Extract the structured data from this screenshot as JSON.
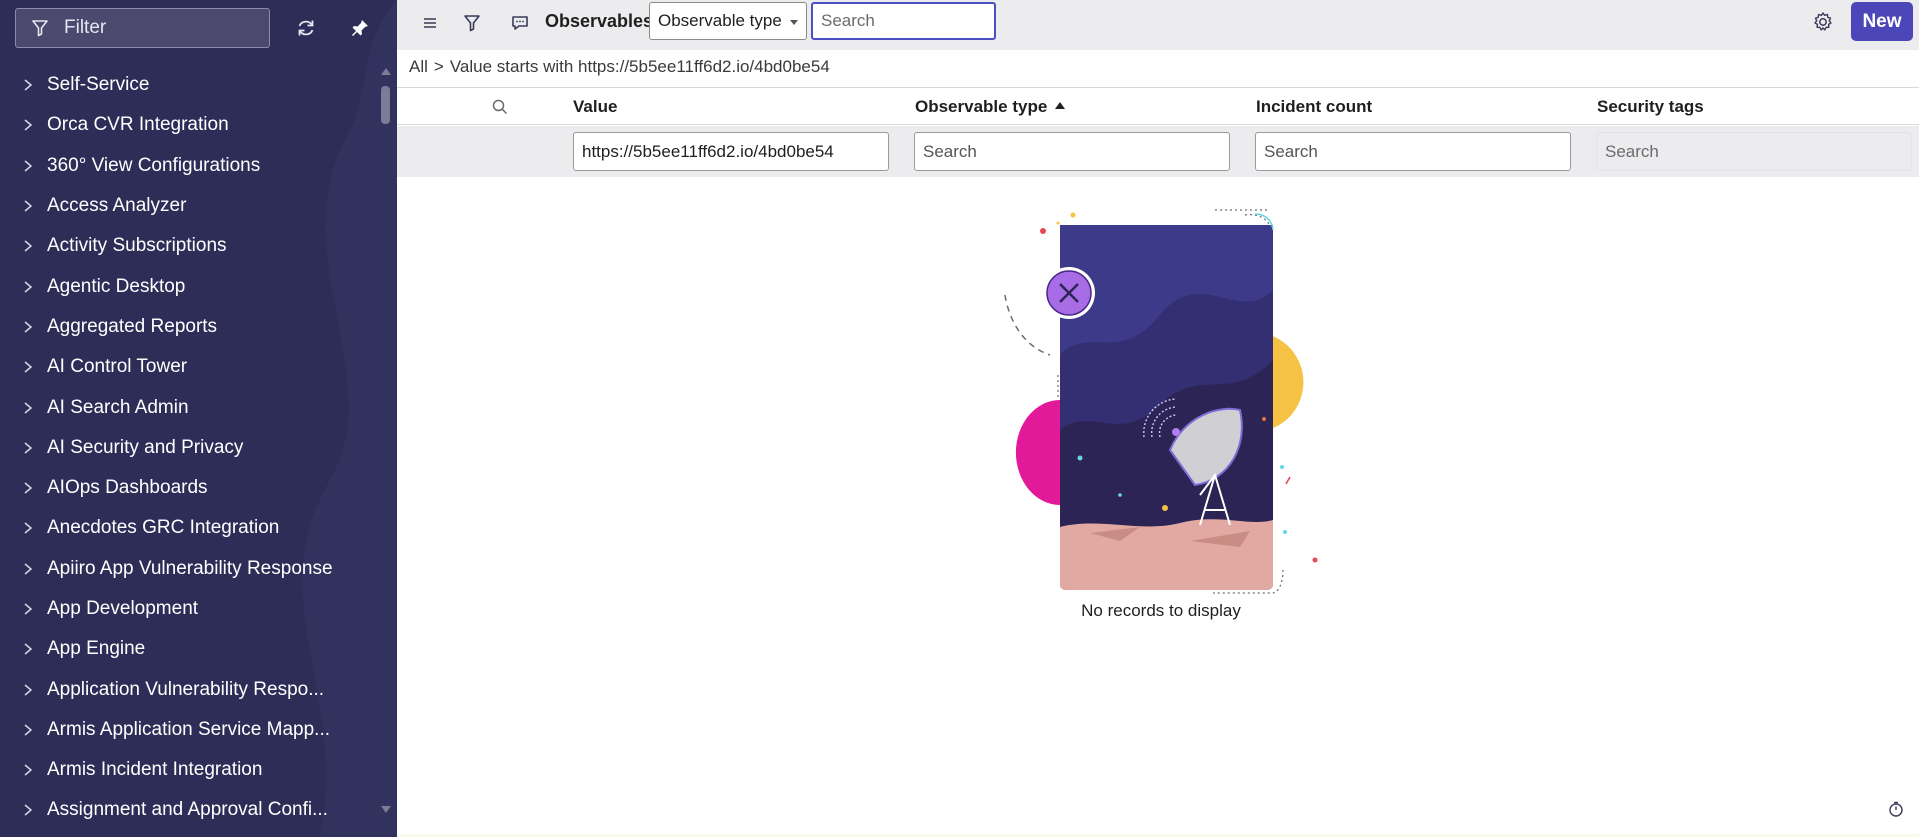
{
  "sidebar": {
    "filter_label": "Filter",
    "items": [
      {
        "label": "Self-Service"
      },
      {
        "label": "Orca CVR Integration"
      },
      {
        "label": "360° View Configurations"
      },
      {
        "label": "Access Analyzer"
      },
      {
        "label": "Activity Subscriptions"
      },
      {
        "label": "Agentic Desktop"
      },
      {
        "label": "Aggregated Reports"
      },
      {
        "label": "AI Control Tower"
      },
      {
        "label": "AI Search Admin"
      },
      {
        "label": "AI Security and Privacy"
      },
      {
        "label": "AIOps Dashboards"
      },
      {
        "label": "Anecdotes GRC Integration"
      },
      {
        "label": "Apiiro App Vulnerability Response"
      },
      {
        "label": "App Development"
      },
      {
        "label": "App Engine"
      },
      {
        "label": "Application Vulnerability Respo..."
      },
      {
        "label": "Armis Application Service Mapp..."
      },
      {
        "label": "Armis Incident Integration"
      },
      {
        "label": "Assignment and Approval Confi..."
      }
    ]
  },
  "toolbar": {
    "title": "Observables",
    "select_value": "Observable type",
    "search_placeholder": "Search",
    "new_label": "New"
  },
  "breadcrumb": {
    "root": "All",
    "separator": ">",
    "condition": "Value starts with https://5b5ee11ff6d2.io/4bd0be54"
  },
  "table": {
    "columns": [
      {
        "label": "Value"
      },
      {
        "label": "Observable type"
      },
      {
        "label": "Incident count"
      },
      {
        "label": "Security tags"
      }
    ],
    "sorted_column": "Observable type",
    "filters": {
      "value": "https://5b5ee11ff6d2.io/4bd0be54",
      "observable_type_placeholder": "Search",
      "incident_count_placeholder": "Search",
      "security_tags_placeholder": "Search"
    }
  },
  "empty_state": {
    "message": "No records to display"
  },
  "colors": {
    "sidebar_bg": "#2e2d57",
    "accent": "#4b47b8",
    "toolbar_bg": "#ececef"
  }
}
